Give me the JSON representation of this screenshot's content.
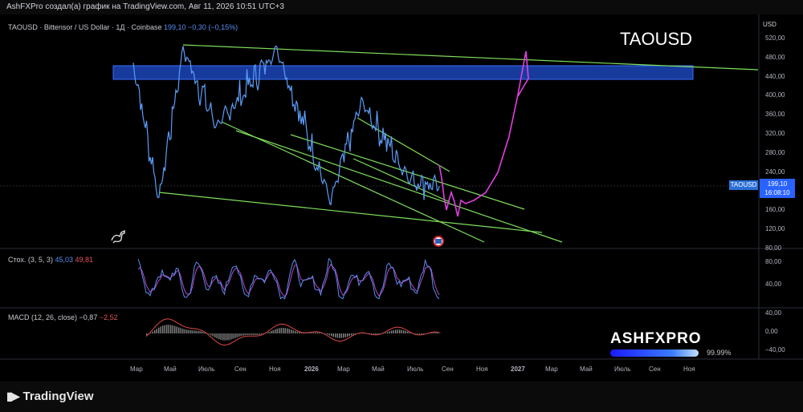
{
  "header": {
    "title": "AshFXPro создал(а) график на TradingView.com, Авг 11, 2026 10:51 UTC+3"
  },
  "legend": {
    "main": "TAOUSD · Bittensor / US Dollar · 1Д · Coinbase",
    "price": "199,10",
    "change": "−0,30 (−0,15%)",
    "stoch_label": "Стох. (3, 5, 3)",
    "stoch_k": "45,03",
    "stoch_d": "49,81",
    "macd_label": "MACD (12, 26, close)",
    "macd_1": "−0,87",
    "macd_2": "−2,52"
  },
  "big_ticker": "TAOUSD",
  "currency": "USD",
  "price_tag": {
    "symbol": "TAOUSD",
    "price": "199,10",
    "countdown": "16:08:10"
  },
  "watermark": {
    "name": "ASHFXPRO",
    "percent": "99.99%"
  },
  "footer": {
    "logo_text": "TradingView"
  },
  "colors": {
    "price_line": "#5b9cf6",
    "trend_lines": "#7ee05b",
    "projection": "#e040e0",
    "zone": "#1e4fd1",
    "stoch_k": "#5b8def",
    "stoch_d": "#b54aca",
    "macd": "#e04848",
    "hist": "#888888"
  },
  "chart_data": [
    {
      "type": "line",
      "name": "TAOUSD price",
      "x_tick_labels": [
        "Мар",
        "Май",
        "Июль",
        "Сен",
        "Ноя",
        "2026",
        "Мар",
        "Май",
        "Июль",
        "Сен",
        "Ноя",
        "2027",
        "Мар",
        "Май",
        "Июль",
        "Сен",
        "Ноя"
      ],
      "y_tick_labels": [
        "520,00",
        "480,00",
        "440,00",
        "400,00",
        "360,00",
        "320,00",
        "280,00",
        "240,00",
        "200,00",
        "160,00",
        "120,00",
        "80,00"
      ],
      "ylim": [
        65,
        545
      ],
      "last_price": 199.1,
      "key_points": [
        {
          "date": "Мар",
          "price": 470
        },
        {
          "date": "Апр",
          "price": 170
        },
        {
          "date": "Май",
          "price": 500
        },
        {
          "date": "Июль",
          "price": 330
        },
        {
          "date": "Ноя",
          "price": 500
        },
        {
          "date": "Янв 2026",
          "price": 165
        },
        {
          "date": "Апр 2026",
          "price": 385
        },
        {
          "date": "Июль 2026",
          "price": 215
        },
        {
          "date": "Авг 2026",
          "price": 199.1
        }
      ],
      "zone": {
        "from": 428,
        "to": 455
      },
      "projection_target": 500
    },
    {
      "type": "line",
      "name": "Stochastic",
      "y_tick_labels": [
        "80,00",
        "40,00"
      ],
      "ylim": [
        10,
        100
      ],
      "last_values": {
        "k": 45.03,
        "d": 49.81
      }
    },
    {
      "type": "bar",
      "name": "MACD",
      "y_tick_labels": [
        "40,00",
        "0,00",
        "−40,00"
      ],
      "ylim": [
        -55,
        50
      ],
      "last_values": {
        "macd": -0.87,
        "signal": -2.52
      }
    }
  ]
}
